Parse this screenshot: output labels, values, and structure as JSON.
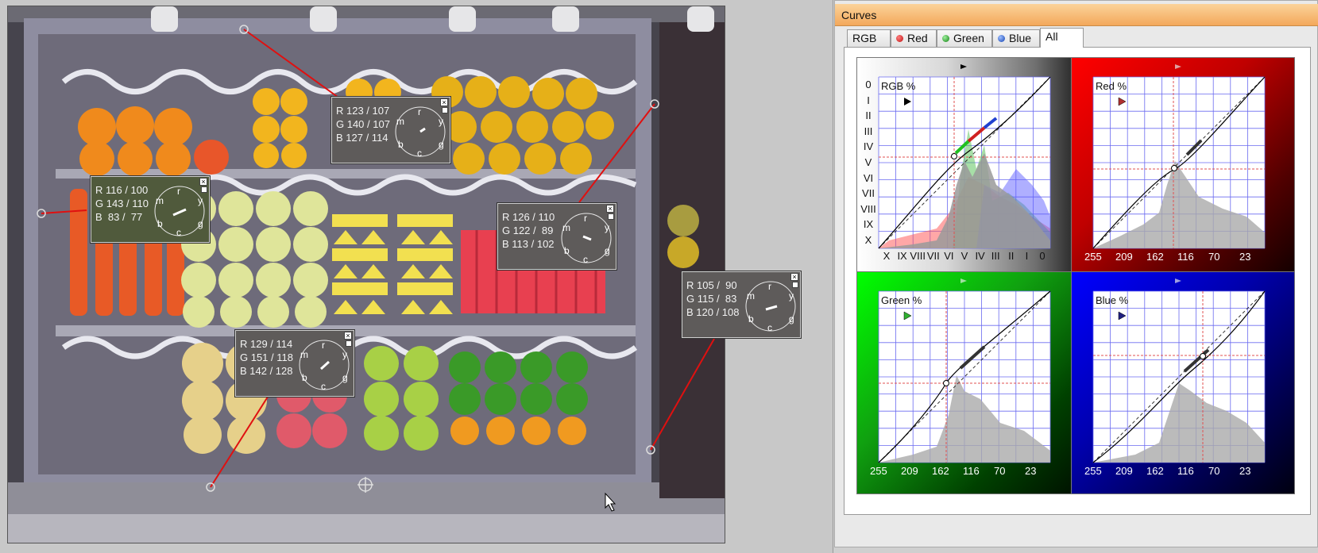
{
  "panel": {
    "title": "Curves",
    "tabs": [
      {
        "label": "RGB",
        "dot": null
      },
      {
        "label": "Red",
        "dot": "#d02020"
      },
      {
        "label": "Green",
        "dot": "#20a020"
      },
      {
        "label": "Blue",
        "dot": "#2050c0"
      },
      {
        "label": "All",
        "dot": null,
        "active": true
      }
    ]
  },
  "probes": [
    {
      "r": "R 123 / 107",
      "g": "G 140 / 107",
      "b": "B 127 / 114"
    },
    {
      "r": "R 116 / 100",
      "g": "G 143 / 110",
      "b": "B  83 /  77"
    },
    {
      "r": "R 126 / 110",
      "g": "G 122 /  89",
      "b": "B 113 / 102"
    },
    {
      "r": "R 105 /  90",
      "g": "G 115 /  83",
      "b": "B 120 / 108"
    },
    {
      "r": "R 129 / 114",
      "g": "G 151 / 118",
      "b": "B 142 / 128"
    }
  ],
  "dial_letters": [
    "r",
    "y",
    "g",
    "c",
    "b",
    "m"
  ],
  "graphs": {
    "rgb": {
      "label": "RGB %",
      "zones": [
        "0",
        "I",
        "II",
        "III",
        "IV",
        "V",
        "VI",
        "VII",
        "VIII",
        "IX",
        "X"
      ],
      "bottom_zones": [
        "X",
        "IX",
        "VIII",
        "VII",
        "VI",
        "V",
        "IV",
        "III",
        "II",
        "I",
        "0"
      ]
    },
    "red": {
      "label": "Red %",
      "ticks": [
        "255",
        "209",
        "162",
        "116",
        "70",
        "23"
      ]
    },
    "green": {
      "label": "Green %",
      "ticks": [
        "255",
        "209",
        "162",
        "116",
        "70",
        "23"
      ]
    },
    "blue": {
      "label": "Blue %",
      "ticks": [
        "255",
        "209",
        "162",
        "116",
        "70",
        "23"
      ]
    }
  },
  "colors": {
    "title_bar": "#f3a85b",
    "red_bg": "#c00000",
    "green_bg": "#10a010",
    "blue_bg": "#0000b0",
    "grid": "#6a6af0"
  }
}
